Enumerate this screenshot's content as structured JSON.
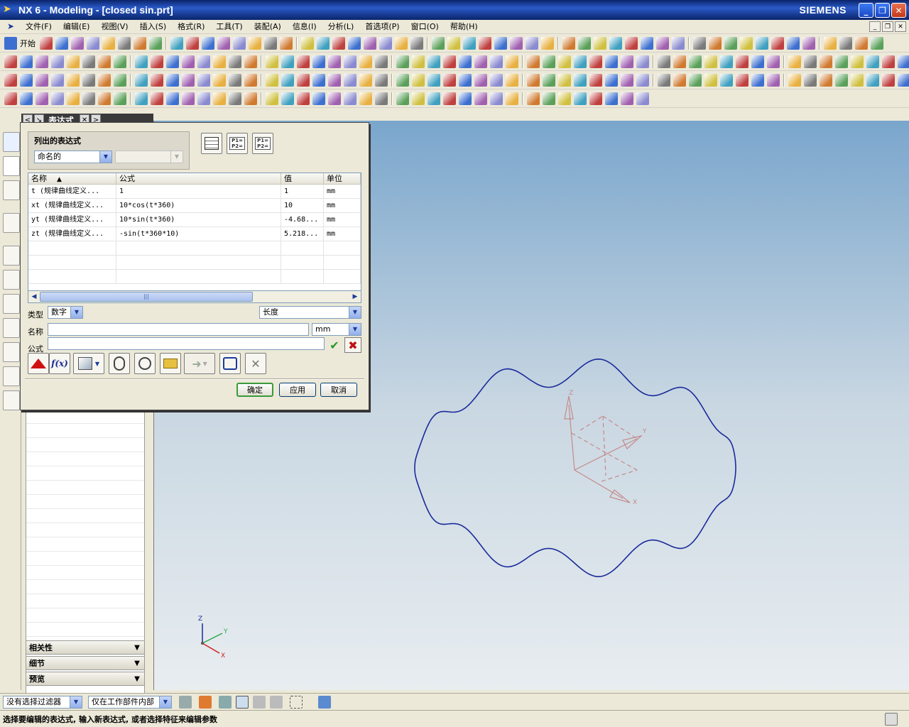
{
  "window": {
    "title": "NX 6 - Modeling - [closed sin.prt]",
    "brand": "SIEMENS"
  },
  "menu": [
    "文件(F)",
    "编辑(E)",
    "视图(V)",
    "插入(S)",
    "格式(R)",
    "工具(T)",
    "装配(A)",
    "信息(I)",
    "分析(L)",
    "首选项(P)",
    "窗口(O)",
    "帮助(H)"
  ],
  "toolbar": {
    "start_label": "开始"
  },
  "navigator": {
    "title": "表达式",
    "sections": [
      "相关性",
      "细节",
      "预览"
    ]
  },
  "dialog": {
    "group_title": "列出的表达式",
    "list_filter": "命名的",
    "columns": [
      "名称",
      "公式",
      "值",
      "单位"
    ],
    "rows": [
      [
        "t  (规律曲线定义...",
        "1",
        "1",
        "mm"
      ],
      [
        "xt  (规律曲线定义...",
        "10*cos(t*360)",
        "10",
        "mm"
      ],
      [
        "yt  (规律曲线定义...",
        "10*sin(t*360)",
        "-4.68...",
        "mm"
      ],
      [
        "zt  (规律曲线定义...",
        "-sin(t*360*10)",
        "5.218...",
        "mm"
      ]
    ],
    "type_label": "类型",
    "type_value": "数字",
    "dimension_value": "长度",
    "name_label": "名称",
    "name_value": "",
    "unit_value": "mm",
    "formula_label": "公式",
    "formula_value": "",
    "list_buttons": [
      "P1= P2=",
      "P1= P2="
    ],
    "fx_label": "f(x)",
    "ok": "确定",
    "apply": "应用",
    "cancel": "取消"
  },
  "viewport": {
    "triad_labels": [
      "Z",
      "Y",
      "X"
    ]
  },
  "filters": {
    "selection_filter": "没有选择过滤器",
    "scope": "仅在工作部件内部"
  },
  "status": "选择要编辑的表达式, 输入新表达式, 或者选择特征来编辑参数",
  "colors": {
    "curve": "#1a2a9a",
    "wcs": "#c48a8a",
    "title_blue": "#0a246a"
  }
}
